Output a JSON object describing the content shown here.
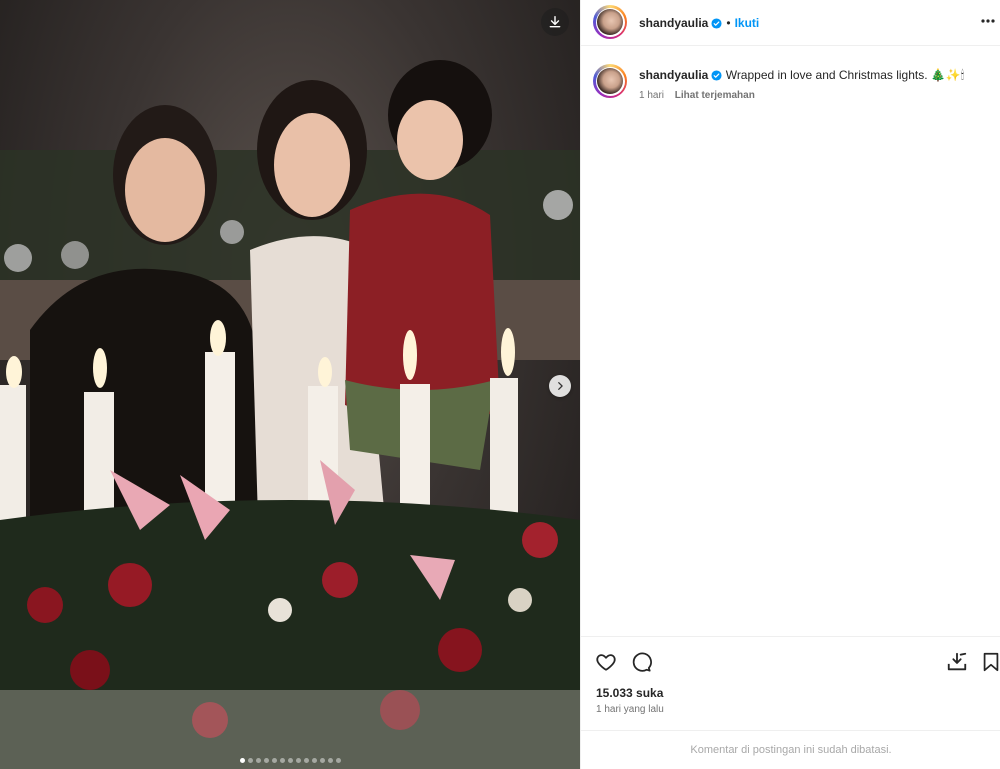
{
  "post": {
    "username": "shandyaulia",
    "follow_label": "Ikuti",
    "separator": "•",
    "caption_username": "shandyaulia",
    "caption_text": "Wrapped in love and Christmas lights.",
    "caption_emoji": "🎄✨🕯",
    "time_ago_short": "1 hari",
    "translate_label": "Lihat terjemahan",
    "likes": "15.033 suka",
    "time_ago_long": "1 hari yang lalu",
    "comments_restricted": "Komentar di postingan ini sudah dibatasi."
  },
  "carousel": {
    "total_slides": 13,
    "active_index": 0
  },
  "icons": {
    "download": "download-icon",
    "next": "chevron-right-icon",
    "more": "more-horizontal-icon",
    "like": "heart-icon",
    "comment": "comment-icon",
    "save_download": "save-download-icon",
    "bookmark": "bookmark-icon",
    "verified": "verified-badge-icon"
  },
  "colors": {
    "accent": "#0095f6",
    "verified": "#0095f6",
    "muted": "#737373"
  }
}
